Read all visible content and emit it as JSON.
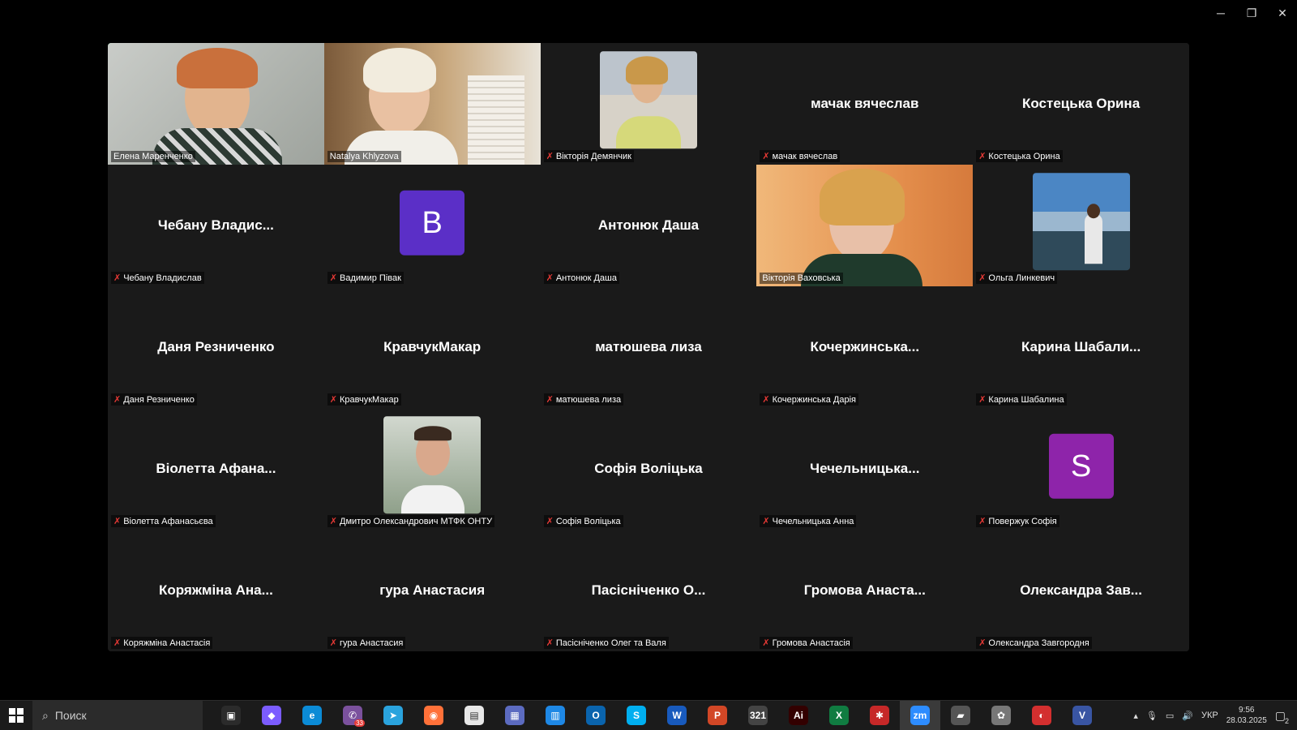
{
  "window": {
    "minimize": "─",
    "restore": "❐",
    "close": "✕"
  },
  "participants": [
    {
      "label": "Елена Маренченко",
      "type": "video",
      "muted": false,
      "active": true
    },
    {
      "label": "Natalya Khlyzova",
      "type": "video",
      "muted": false
    },
    {
      "label": "Вікторія Демянчик",
      "type": "photo",
      "muted": true
    },
    {
      "display": "мачак вячеслав",
      "label": "мачак вячеслав",
      "type": "name",
      "muted": true
    },
    {
      "display": "Костецька Орина",
      "label": "Костецька Орина",
      "type": "name",
      "muted": true
    },
    {
      "display": "Чебану Владис...",
      "label": "Чебану Владислав",
      "type": "name",
      "muted": true
    },
    {
      "avatar": "B",
      "label": "Вадимир Півак",
      "type": "avatar",
      "color": "#5b2fc7",
      "muted": true
    },
    {
      "display": "Антонюк Даша",
      "label": "Антонюк Даша",
      "type": "name",
      "muted": true
    },
    {
      "label": "Вікторія Ваховська",
      "type": "video",
      "muted": false
    },
    {
      "label": "Ольга Линкевич",
      "type": "photo",
      "muted": true
    },
    {
      "display": "Даня Резниченко",
      "label": "Даня Резниченко",
      "type": "name",
      "muted": true
    },
    {
      "display": "КравчукМакар",
      "label": "КравчукМакар",
      "type": "name",
      "muted": true
    },
    {
      "display": "матюшева лиза",
      "label": "матюшева лиза",
      "type": "name",
      "muted": true
    },
    {
      "display": "Кочержинська...",
      "label": "Кочержинська Дарія",
      "type": "name",
      "muted": true
    },
    {
      "display": "Карина Шабали...",
      "label": "Карина Шабалина",
      "type": "name",
      "muted": true
    },
    {
      "display": "Віолетта Афана...",
      "label": "Віолетта Афанасьєва",
      "type": "name",
      "muted": true
    },
    {
      "label": "Дмитро Олександрович МТФК ОНТУ",
      "type": "photo",
      "muted": true
    },
    {
      "display": "Софія Воліцька",
      "label": "Софія Воліцька",
      "type": "name",
      "muted": true
    },
    {
      "display": "Чечельницька...",
      "label": "Чечельницька Анна",
      "type": "name",
      "muted": true
    },
    {
      "avatar": "S",
      "label": "Повержук Софія",
      "type": "avatar",
      "color": "#8e24aa",
      "muted": true
    },
    {
      "display": "Коряжміна Ана...",
      "label": "Коряжміна Анастасія",
      "type": "name",
      "muted": true
    },
    {
      "display": "гура Анастасия",
      "label": "гура Анастасия",
      "type": "name",
      "muted": true
    },
    {
      "display": "Пасісніченко О...",
      "label": "Пасісніченко Олег та Валя",
      "type": "name",
      "muted": true
    },
    {
      "display": "Громова Анаста...",
      "label": "Громова Анастасія",
      "type": "name",
      "muted": true
    },
    {
      "display": "Олександра Зав...",
      "label": "Олександра Завгородня",
      "type": "name",
      "muted": true
    }
  ],
  "taskbar": {
    "search_placeholder": "Поиск",
    "apps": [
      {
        "name": "task-view",
        "glyph": "▣",
        "color": "#2b2b2b"
      },
      {
        "name": "copilot",
        "glyph": "◆",
        "color": "#7b5cff"
      },
      {
        "name": "edge",
        "glyph": "e",
        "color": "#0b8bd6"
      },
      {
        "name": "viber",
        "glyph": "✆",
        "color": "#7b519d",
        "badge": "33"
      },
      {
        "name": "telegram",
        "glyph": "➤",
        "color": "#2aa3dd"
      },
      {
        "name": "firefox",
        "glyph": "◉",
        "color": "#ff7139"
      },
      {
        "name": "notepad",
        "glyph": "▤",
        "color": "#e8e8e8"
      },
      {
        "name": "calculator",
        "glyph": "▦",
        "color": "#5c6bc0"
      },
      {
        "name": "calendar",
        "glyph": "▥",
        "color": "#1e88e5"
      },
      {
        "name": "outlook",
        "glyph": "O",
        "color": "#0a64ad"
      },
      {
        "name": "skype",
        "glyph": "S",
        "color": "#00aff0"
      },
      {
        "name": "word",
        "glyph": "W",
        "color": "#185abd"
      },
      {
        "name": "powerpoint",
        "glyph": "P",
        "color": "#d24726"
      },
      {
        "name": "media-player",
        "glyph": "321",
        "color": "#444"
      },
      {
        "name": "illustrator",
        "glyph": "Ai",
        "color": "#330000"
      },
      {
        "name": "excel",
        "glyph": "X",
        "color": "#107c41"
      },
      {
        "name": "paint",
        "glyph": "✱",
        "color": "#c62828"
      },
      {
        "name": "zoom",
        "glyph": "zm",
        "color": "#2d8cff",
        "active": true
      },
      {
        "name": "scanner",
        "glyph": "▰",
        "color": "#555"
      },
      {
        "name": "brain-app",
        "glyph": "✿",
        "color": "#777"
      },
      {
        "name": "opera",
        "glyph": "◐",
        "color": "#d32f2f"
      },
      {
        "name": "visio",
        "glyph": "V",
        "color": "#3955a3"
      }
    ],
    "lang": "УКР",
    "time": "9:56",
    "date": "28.03.2025",
    "notif_count": "2"
  }
}
